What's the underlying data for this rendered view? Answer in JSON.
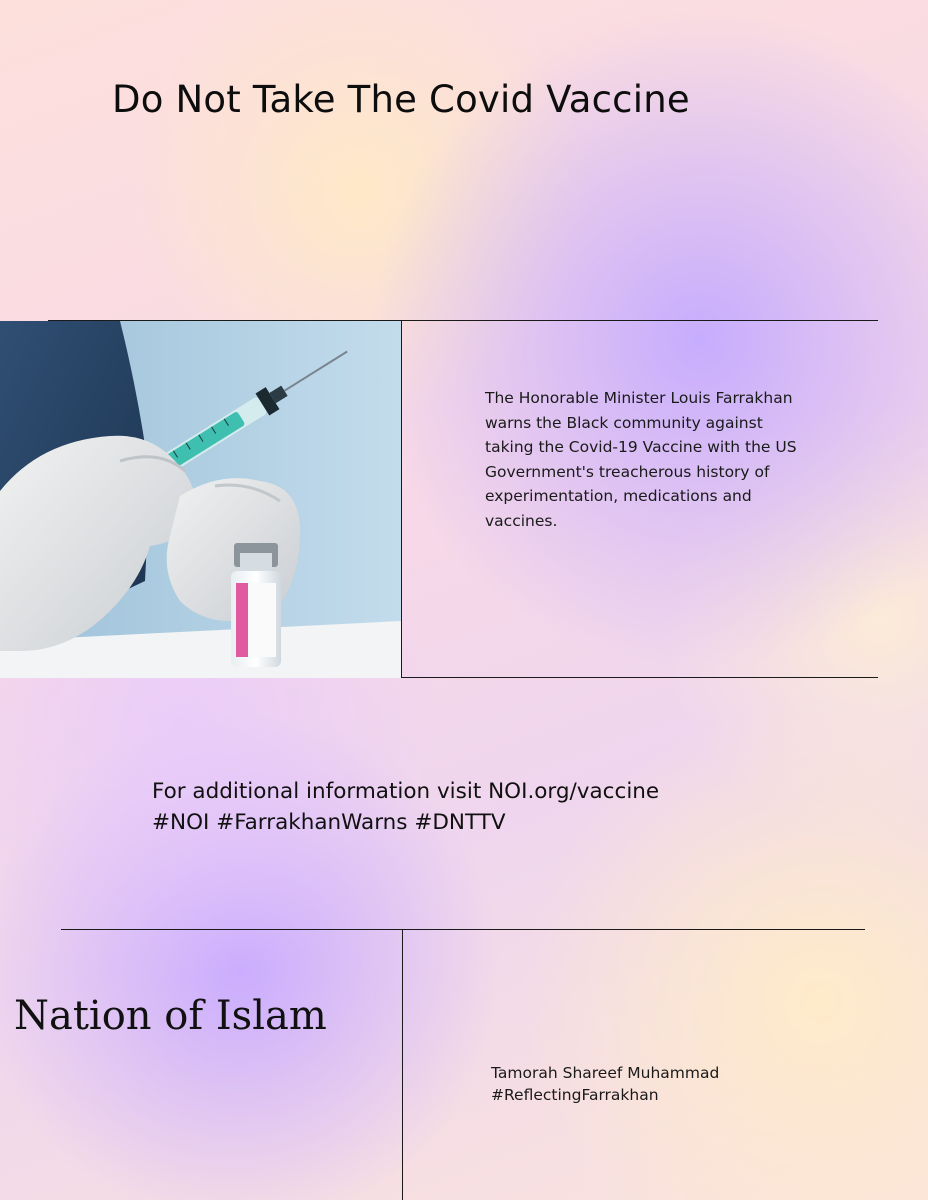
{
  "title": "Do Not Take The Covid Vaccine",
  "image": {
    "subject": "syringe-vaccine-photo"
  },
  "body_text": "The Honorable Minister Louis Farrakhan warns the Black community against taking the Covid-19 Vaccine with the US Government's treacherous history of experimentation, medications and vaccines.",
  "info": {
    "line1": "For additional information visit NOI.org/vaccine",
    "line2": "#NOI #FarrakhanWarns #DNTTV"
  },
  "organization": "Nation of Islam",
  "author": {
    "name": "Tamorah Shareef Muhammad",
    "tag": "#ReflectingFarrakhan"
  }
}
